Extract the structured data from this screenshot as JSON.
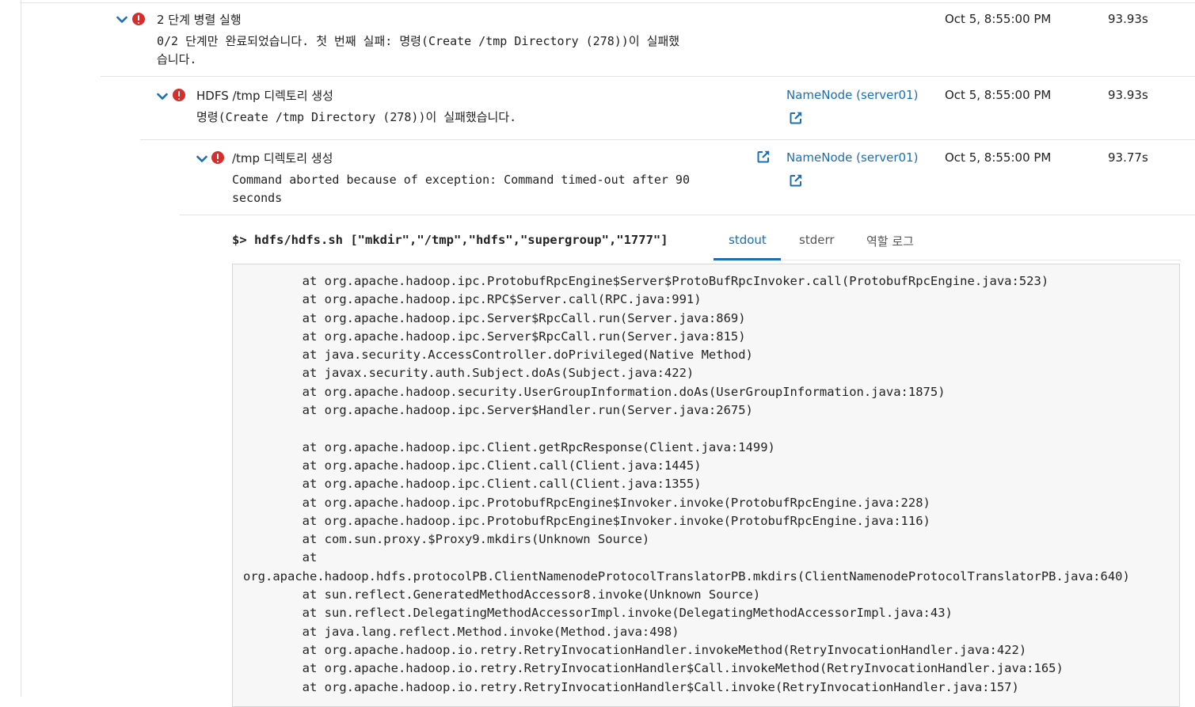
{
  "steps": [
    {
      "title": "2 단계 병렬 실행",
      "message": "0/2 단계만 완료되었습니다. 첫 번째 실패: 명령(Create /tmp Directory (278))이 실패했\n습니다.",
      "host": "",
      "date": "Oct 5, 8:55:00 PM",
      "duration": "93.93s"
    },
    {
      "title": "HDFS /tmp 디렉토리 생성",
      "message": "명령(Create /tmp Directory (278))이 실패했습니다.",
      "host": "NameNode (server01)",
      "date": "Oct 5, 8:55:00 PM",
      "duration": "93.93s"
    },
    {
      "title": "/tmp 디렉토리 생성",
      "message": "Command aborted because of exception: Command timed-out after 90\nseconds",
      "host": "NameNode (server01)",
      "date": "Oct 5, 8:55:00 PM",
      "duration": "93.77s"
    }
  ],
  "command": {
    "prompt": "$>",
    "text": "hdfs/hdfs.sh [\"mkdir\",\"/tmp\",\"hdfs\",\"supergroup\",\"1777\"]"
  },
  "tabs": [
    {
      "label": "stdout",
      "active": true
    },
    {
      "label": "stderr",
      "active": false
    },
    {
      "label": "역할 로그",
      "active": false
    }
  ],
  "log_lines": [
    "        at org.apache.hadoop.ipc.ProtobufRpcEngine$Server$ProtoBufRpcInvoker.call(ProtobufRpcEngine.java:523)",
    "        at org.apache.hadoop.ipc.RPC$Server.call(RPC.java:991)",
    "        at org.apache.hadoop.ipc.Server$RpcCall.run(Server.java:869)",
    "        at org.apache.hadoop.ipc.Server$RpcCall.run(Server.java:815)",
    "        at java.security.AccessController.doPrivileged(Native Method)",
    "        at javax.security.auth.Subject.doAs(Subject.java:422)",
    "        at org.apache.hadoop.security.UserGroupInformation.doAs(UserGroupInformation.java:1875)",
    "        at org.apache.hadoop.ipc.Server$Handler.run(Server.java:2675)",
    "",
    "        at org.apache.hadoop.ipc.Client.getRpcResponse(Client.java:1499)",
    "        at org.apache.hadoop.ipc.Client.call(Client.java:1445)",
    "        at org.apache.hadoop.ipc.Client.call(Client.java:1355)",
    "        at org.apache.hadoop.ipc.ProtobufRpcEngine$Invoker.invoke(ProtobufRpcEngine.java:228)",
    "        at org.apache.hadoop.ipc.ProtobufRpcEngine$Invoker.invoke(ProtobufRpcEngine.java:116)",
    "        at com.sun.proxy.$Proxy9.mkdirs(Unknown Source)",
    "        at",
    "org.apache.hadoop.hdfs.protocolPB.ClientNamenodeProtocolTranslatorPB.mkdirs(ClientNamenodeProtocolTranslatorPB.java:640)",
    "        at sun.reflect.GeneratedMethodAccessor8.invoke(Unknown Source)",
    "        at sun.reflect.DelegatingMethodAccessorImpl.invoke(DelegatingMethodAccessorImpl.java:43)",
    "        at java.lang.reflect.Method.invoke(Method.java:498)",
    "        at org.apache.hadoop.io.retry.RetryInvocationHandler.invokeMethod(RetryInvocationHandler.java:422)",
    "        at org.apache.hadoop.io.retry.RetryInvocationHandler$Call.invokeMethod(RetryInvocationHandler.java:165)",
    "        at org.apache.hadoop.io.retry.RetryInvocationHandler$Call.invoke(RetryInvocationHandler.java:157)"
  ],
  "colors": {
    "link": "#1a6fb3",
    "error": "#d32f2f",
    "log_background": "#f7f7f7"
  },
  "icons": {
    "expand": "chevron-down-icon",
    "status": "error-icon",
    "open": "external-link-icon"
  }
}
